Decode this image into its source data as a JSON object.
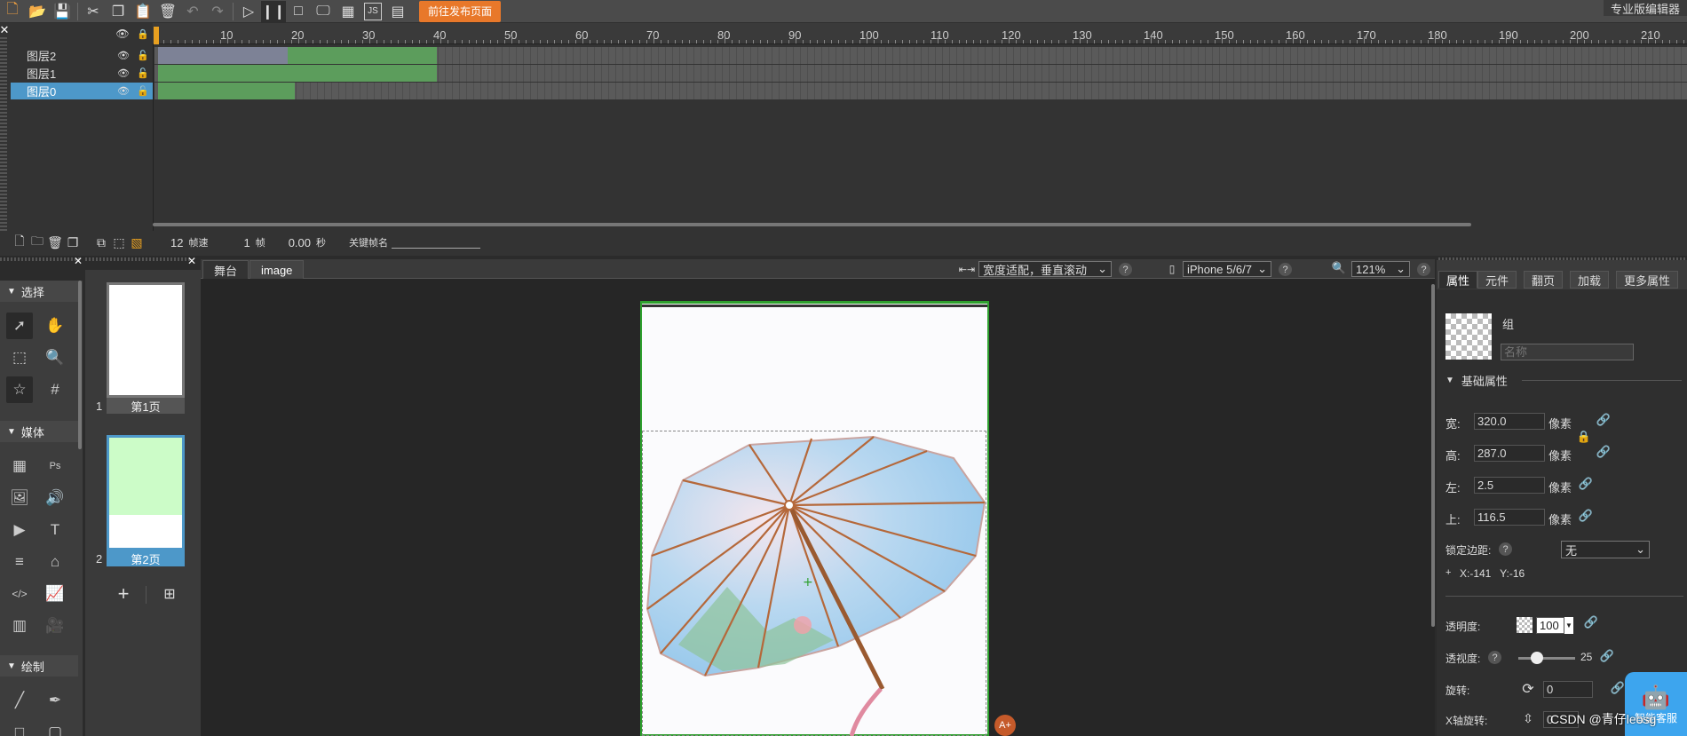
{
  "toolbar": {
    "publish_label": "前往发布页面",
    "pro_badge": "专业版编辑器"
  },
  "timeline": {
    "ruler_ticks": [
      "10",
      "20",
      "30",
      "40",
      "50",
      "60",
      "70",
      "80",
      "90",
      "100",
      "110",
      "120",
      "130",
      "140",
      "150",
      "160",
      "170",
      "180",
      "190",
      "200",
      "210"
    ],
    "layers": [
      {
        "name": "图层2",
        "selected": false
      },
      {
        "name": "图层1",
        "selected": false
      },
      {
        "name": "图层0",
        "selected": true
      }
    ],
    "status": {
      "fps_value": "12",
      "fps_label": "帧速",
      "frame_value": "1",
      "frame_label": "帧",
      "time_value": "0.00",
      "time_label": "秒",
      "keyframe_label": "关键帧名"
    }
  },
  "tools": {
    "sections": [
      "选择",
      "媒体",
      "绘制"
    ]
  },
  "pages": [
    {
      "num": "1",
      "label": "第1页"
    },
    {
      "num": "2",
      "label": "第2页"
    }
  ],
  "canvas": {
    "tabs": [
      "舞台",
      "image"
    ],
    "fit_mode": "宽度适配，垂直滚动",
    "device": "iPhone 5/6/7",
    "zoom": "121%"
  },
  "props": {
    "tabs": [
      "属性",
      "元件",
      "翻页",
      "加载",
      "更多属性"
    ],
    "group_label": "组",
    "name_placeholder": "名称",
    "section_title": "基础属性",
    "width_label": "宽:",
    "width_value": "320.0",
    "height_label": "高:",
    "height_value": "287.0",
    "left_label": "左:",
    "left_value": "2.5",
    "top_label": "上:",
    "top_value": "116.5",
    "unit": "像素",
    "lock_margin_label": "锁定边距:",
    "lock_margin_value": "无",
    "coords": "X:-141   Y:-16",
    "opacity_label": "透明度:",
    "opacity_value": "100",
    "perspective_label": "透视度:",
    "perspective_value": "25",
    "rotate_label": "旋转:",
    "rotate_value": "0",
    "xrotate_label": "X轴旋转:",
    "xrotate_value": "0"
  },
  "assistant_label": "智能客服",
  "watermark": "CSDN @青仔leosg",
  "colors": {
    "accent_orange": "#e8782a",
    "keyframe_green": "#5c9d5c",
    "stage_border": "#2ea02e",
    "selected_blue": "#4d98c9",
    "assistant_blue": "#3da5ee"
  }
}
